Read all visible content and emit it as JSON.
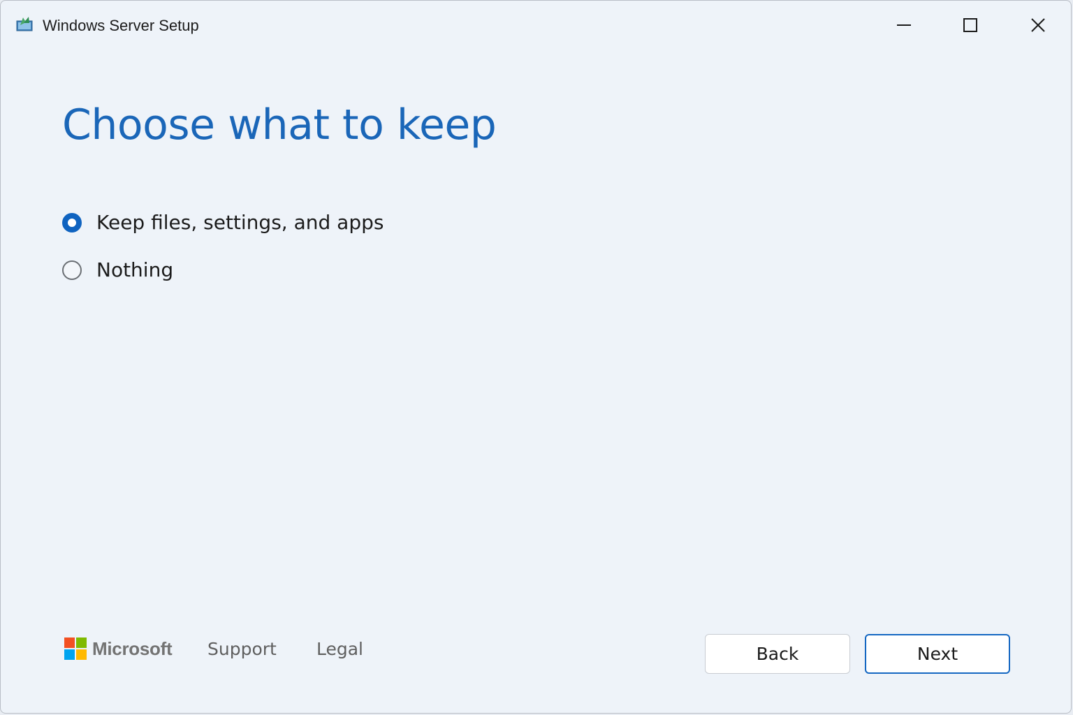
{
  "window": {
    "title": "Windows Server Setup",
    "controls": {
      "minimize_icon": "minimize-icon",
      "maximize_icon": "maximize-icon",
      "close_icon": "close-icon"
    }
  },
  "page": {
    "heading": "Choose what to keep",
    "options": [
      {
        "label": "Keep files, settings, and apps",
        "selected": true
      },
      {
        "label": "Nothing",
        "selected": false
      }
    ]
  },
  "footer": {
    "brand": "Microsoft",
    "links": [
      "Support",
      "Legal"
    ],
    "buttons": {
      "back": "Back",
      "next": "Next"
    }
  },
  "colors": {
    "accent": "#0f63c0",
    "heading": "#1a66b8",
    "background": "#eef3f9",
    "ms_red": "#f25022",
    "ms_green": "#7fba00",
    "ms_blue": "#00a4ef",
    "ms_yellow": "#ffb900"
  }
}
